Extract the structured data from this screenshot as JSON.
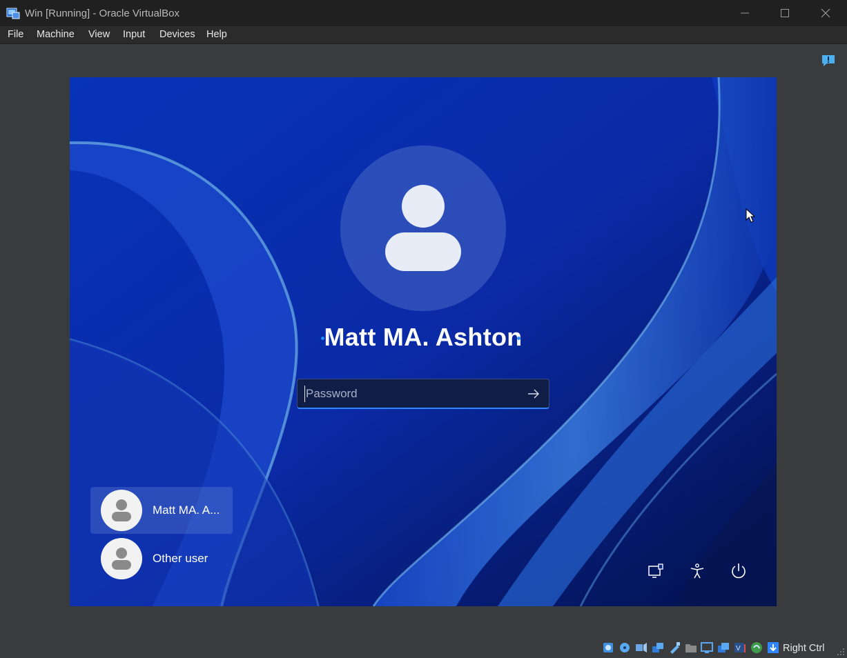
{
  "window": {
    "title": "Win [Running] - Oracle VirtualBox",
    "icons": [
      "virtualbox-app-icon",
      "minimize-icon",
      "maximize-icon",
      "close-icon"
    ]
  },
  "menu": {
    "items": [
      "File",
      "Machine",
      "View",
      "Input",
      "Devices",
      "Help"
    ]
  },
  "notification": {
    "icon": "feedback-exclamation-icon"
  },
  "login": {
    "username": "Matt MA. Ashton",
    "password_placeholder": "Password",
    "password_value": "",
    "submit_icon": "arrow-right-icon",
    "users": [
      {
        "name": "Matt MA. A...",
        "selected": true
      },
      {
        "name": "Other user",
        "selected": false
      }
    ],
    "system_buttons": [
      "network-icon",
      "accessibility-icon",
      "power-icon"
    ]
  },
  "statusbar": {
    "host_key": "Right Ctrl",
    "icons": [
      "hard-disk-icon",
      "optical-drive-icon",
      "audio-icon",
      "network-adapters-icon",
      "usb-icon",
      "shared-folders-icon",
      "display-icon",
      "recording-icon",
      "cpu-virtualization-icon",
      "mouse-integration-icon",
      "keyboard-capture-icon"
    ]
  },
  "colors": {
    "titlebar": "#202020",
    "menubar": "#2b2b2b",
    "background": "#3a3b3d",
    "accent": "#2f86ff"
  }
}
